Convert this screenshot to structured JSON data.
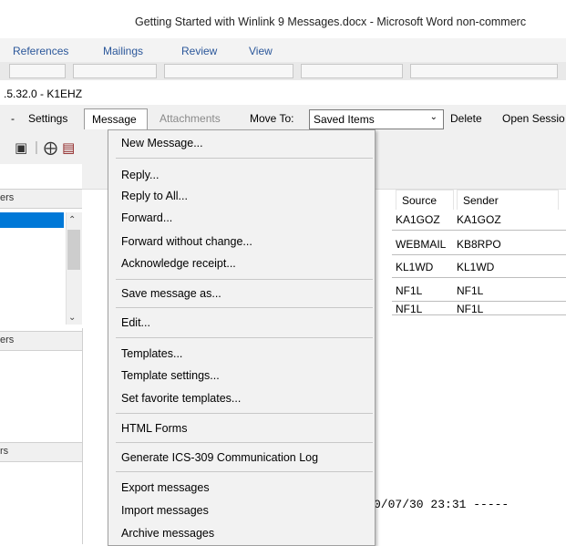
{
  "word": {
    "title": "Getting Started with Winlink 9 Messages.docx - Microsoft Word non-commerc",
    "tabs": [
      "References",
      "Mailings",
      "Review",
      "View"
    ]
  },
  "winlink": {
    "title": ".5.32.0 - K1EHZ",
    "menubar": {
      "arrow": "-",
      "settings": "Settings",
      "message": "Message",
      "attachments": "Attachments",
      "move_to": "Move To:",
      "folder_value": "Saved Items",
      "delete": "Delete",
      "open_session": "Open Sessio"
    },
    "left_pane": {
      "header1": "ers",
      "header2": "ers",
      "header3": "rs"
    },
    "grid": {
      "columns": [
        "Source",
        "Sender"
      ],
      "rows": [
        [
          "KA1GOZ",
          "KA1GOZ"
        ],
        [
          "WEBMAIL",
          "KB8RPO"
        ],
        [
          "KL1WD",
          "KL1WD"
        ],
        [
          "NF1L",
          "NF1L"
        ],
        [
          "NF1L",
          "NF1L"
        ]
      ]
    },
    "preview_text": "0/07/30 23:31 -----"
  },
  "dropdown": {
    "items": [
      "New Message...",
      "Reply...",
      "Reply to All...",
      "Forward...",
      "Forward without change...",
      "Acknowledge receipt...",
      "Save message as...",
      "Edit...",
      "Templates...",
      "Template settings...",
      "Set favorite templates...",
      "HTML Forms",
      "Generate ICS-309 Communication Log",
      "Export messages",
      "Import messages",
      "Archive messages"
    ]
  },
  "colors": {
    "selection": "#0078d7",
    "word_tab_text": "#2b579a"
  }
}
